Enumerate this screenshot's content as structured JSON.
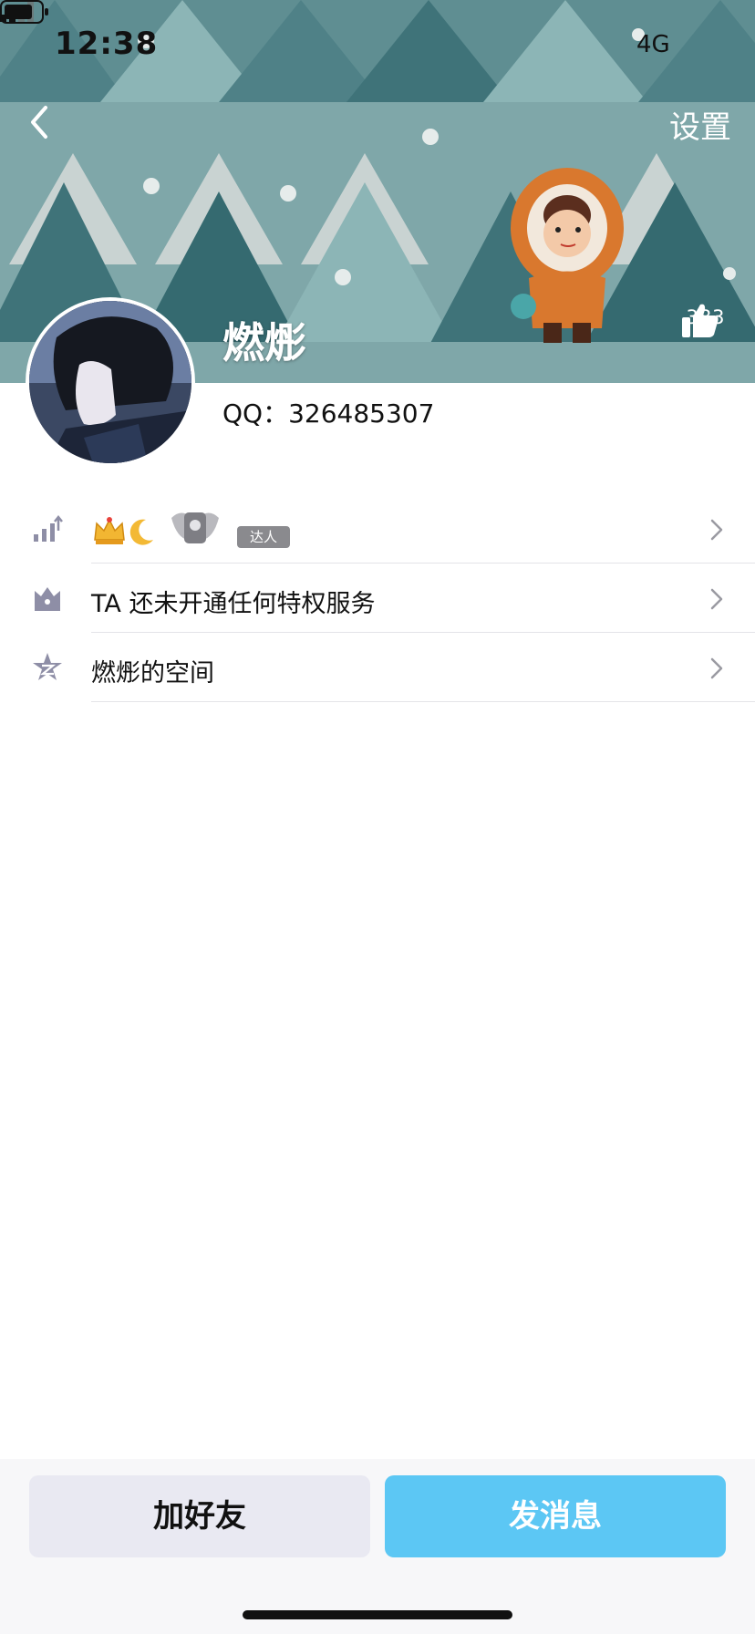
{
  "status_bar": {
    "time": "12:38",
    "network": "4G"
  },
  "header": {
    "settings_label": "设置",
    "nickname": "燃烿",
    "like_count": "383"
  },
  "profile": {
    "qq_number": "QQ：326485307"
  },
  "list": {
    "badge_label": "达人",
    "privilege_text": "TA 还未开通任何特权服务",
    "space_text": "燃烿的空间"
  },
  "actions": {
    "add_friend": "加好友",
    "send_message": "发消息"
  },
  "colors": {
    "banner_bg": "#7fa7a9",
    "primary_button": "#5cc7f4",
    "secondary_button": "#e9e9f2",
    "icon_gray": "#8e8ea6"
  },
  "icons": [
    "back-icon",
    "thumbs-up-icon",
    "level-icon",
    "crown-icon",
    "moon-icon",
    "privilege-icon",
    "qzone-icon",
    "chevron-right-icon"
  ]
}
